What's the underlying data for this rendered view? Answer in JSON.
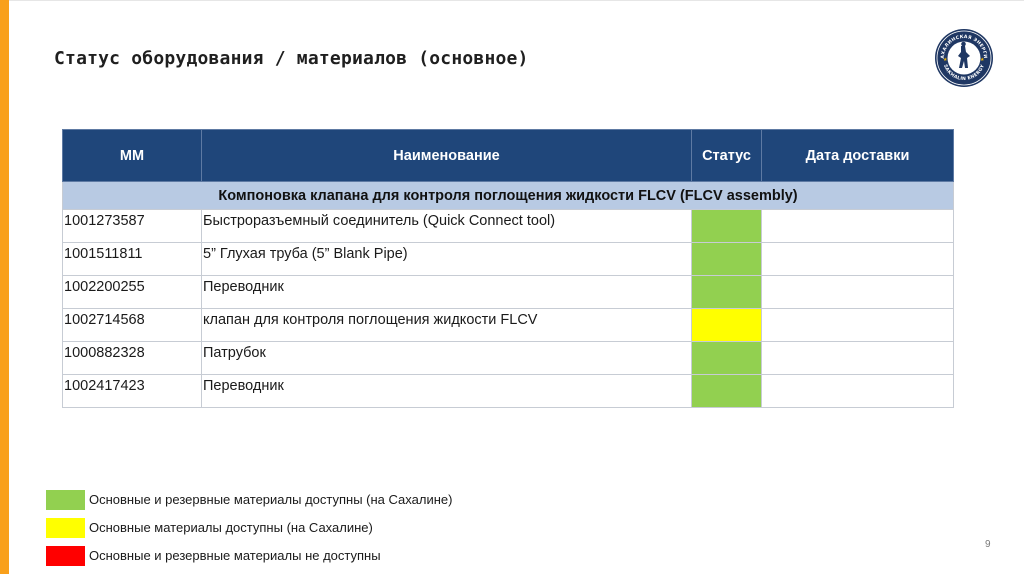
{
  "slide": {
    "title": "Статус оборудования / материалов (основное)",
    "page_number": "9",
    "accent_color": "#f9a01b"
  },
  "logo": {
    "icon": "sakhalin-energy-logo",
    "text_top": "САХАЛИНСКАЯ ЭНЕРГИЯ",
    "text_bottom": "SAKHALIN ENERGY"
  },
  "table": {
    "headers": [
      "MM",
      "Наименование",
      "Статус",
      "Дата доставки"
    ],
    "group_title": "Компоновка клапана для контроля поглощения жидкости FLCV (FLCV assembly)",
    "rows": [
      {
        "mm": "1001273587",
        "name": "Быстроразъемный соединитель (Quick Connect tool)",
        "status_color": "#92d050",
        "delivery": ""
      },
      {
        "mm": "1001511811",
        "name": "5” Глухая труба (5” Blank Pipe)",
        "status_color": "#92d050",
        "delivery": ""
      },
      {
        "mm": "1002200255",
        "name": "Переводник",
        "status_color": "#92d050",
        "delivery": ""
      },
      {
        "mm": "1002714568",
        "name": "клапан для контроля поглощения жидкости FLCV",
        "status_color": "#ffff00",
        "delivery": ""
      },
      {
        "mm": "1000882328",
        "name": "Патрубок",
        "status_color": "#92d050",
        "delivery": ""
      },
      {
        "mm": "1002417423",
        "name": "Переводник",
        "status_color": "#92d050",
        "delivery": ""
      }
    ]
  },
  "legend": [
    {
      "color": "#92d050",
      "label": "Основные и резервные материалы доступны (на Сахалине)"
    },
    {
      "color": "#ffff00",
      "label": "Основные материалы доступны (на Сахалине)"
    },
    {
      "color": "#ff0000",
      "label": "Основные и резервные материалы не доступны"
    }
  ]
}
